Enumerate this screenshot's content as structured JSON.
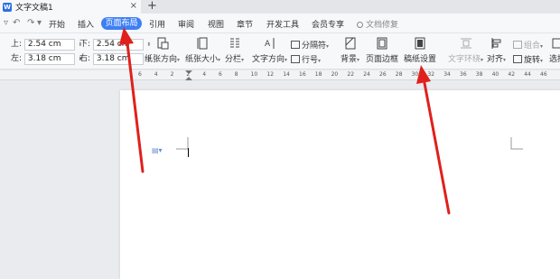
{
  "title_tab": {
    "name": "文字文稿1",
    "close": "×",
    "new_tab": "+"
  },
  "menu": {
    "items": [
      "开始",
      "插入",
      "页面布局",
      "引用",
      "审阅",
      "视图",
      "章节",
      "开发工具",
      "会员专享"
    ],
    "active": "页面布局",
    "search_label": "文档修复"
  },
  "margins": {
    "top_label": "上:",
    "top_value": "2.54 cm",
    "bottom_label": "下:",
    "bottom_value": "2.54 cm",
    "left_label": "左:",
    "left_value": "3.18 cm",
    "right_label": "右:",
    "right_value": "3.18 cm"
  },
  "ribbon": {
    "orientation": "纸张方向",
    "size": "纸张大小",
    "columns": "分栏",
    "text_direction": "文字方向",
    "separator": "分隔符",
    "line_numbers": "行号",
    "background": "背景",
    "page_border": "页面边框",
    "manuscript": "稿纸设置",
    "text_wrap": "文字环绕",
    "align": "对齐",
    "group": "组合",
    "rotate": "旋转",
    "selection_pane": "选择"
  },
  "ruler": {
    "ticks": [
      "6",
      "4",
      "2",
      "2",
      "4",
      "6",
      "8",
      "10",
      "12",
      "14",
      "16",
      "18",
      "20",
      "22",
      "24",
      "26",
      "28",
      "30",
      "32",
      "34",
      "36",
      "38",
      "40",
      "42",
      "44",
      "46"
    ]
  },
  "colors": {
    "accent": "#3d7ff5",
    "arrow": "#e0201c",
    "canvas": "#e9ebee"
  }
}
